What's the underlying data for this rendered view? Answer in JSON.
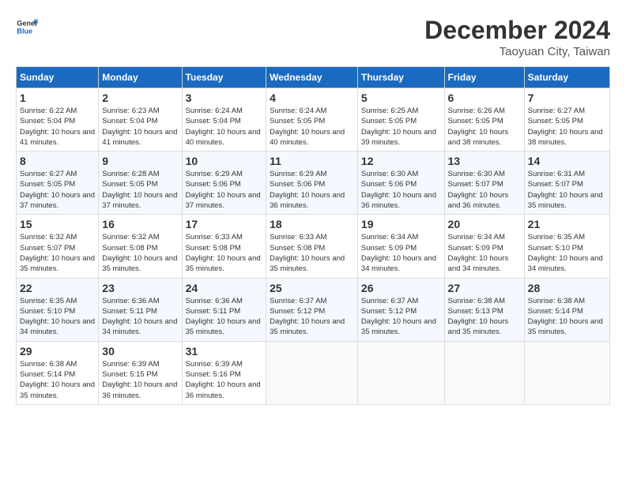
{
  "header": {
    "logo_line1": "General",
    "logo_line2": "Blue",
    "month_title": "December 2024",
    "subtitle": "Taoyuan City, Taiwan"
  },
  "weekdays": [
    "Sunday",
    "Monday",
    "Tuesday",
    "Wednesday",
    "Thursday",
    "Friday",
    "Saturday"
  ],
  "weeks": [
    [
      {
        "day": 1,
        "sunrise": "6:22 AM",
        "sunset": "5:04 PM",
        "daylight": "10 hours and 41 minutes."
      },
      {
        "day": 2,
        "sunrise": "6:23 AM",
        "sunset": "5:04 PM",
        "daylight": "10 hours and 41 minutes."
      },
      {
        "day": 3,
        "sunrise": "6:24 AM",
        "sunset": "5:04 PM",
        "daylight": "10 hours and 40 minutes."
      },
      {
        "day": 4,
        "sunrise": "6:24 AM",
        "sunset": "5:05 PM",
        "daylight": "10 hours and 40 minutes."
      },
      {
        "day": 5,
        "sunrise": "6:25 AM",
        "sunset": "5:05 PM",
        "daylight": "10 hours and 39 minutes."
      },
      {
        "day": 6,
        "sunrise": "6:26 AM",
        "sunset": "5:05 PM",
        "daylight": "10 hours and 38 minutes."
      },
      {
        "day": 7,
        "sunrise": "6:27 AM",
        "sunset": "5:05 PM",
        "daylight": "10 hours and 38 minutes."
      }
    ],
    [
      {
        "day": 8,
        "sunrise": "6:27 AM",
        "sunset": "5:05 PM",
        "daylight": "10 hours and 37 minutes."
      },
      {
        "day": 9,
        "sunrise": "6:28 AM",
        "sunset": "5:05 PM",
        "daylight": "10 hours and 37 minutes."
      },
      {
        "day": 10,
        "sunrise": "6:29 AM",
        "sunset": "5:06 PM",
        "daylight": "10 hours and 37 minutes."
      },
      {
        "day": 11,
        "sunrise": "6:29 AM",
        "sunset": "5:06 PM",
        "daylight": "10 hours and 36 minutes."
      },
      {
        "day": 12,
        "sunrise": "6:30 AM",
        "sunset": "5:06 PM",
        "daylight": "10 hours and 36 minutes."
      },
      {
        "day": 13,
        "sunrise": "6:30 AM",
        "sunset": "5:07 PM",
        "daylight": "10 hours and 36 minutes."
      },
      {
        "day": 14,
        "sunrise": "6:31 AM",
        "sunset": "5:07 PM",
        "daylight": "10 hours and 35 minutes."
      }
    ],
    [
      {
        "day": 15,
        "sunrise": "6:32 AM",
        "sunset": "5:07 PM",
        "daylight": "10 hours and 35 minutes."
      },
      {
        "day": 16,
        "sunrise": "6:32 AM",
        "sunset": "5:08 PM",
        "daylight": "10 hours and 35 minutes."
      },
      {
        "day": 17,
        "sunrise": "6:33 AM",
        "sunset": "5:08 PM",
        "daylight": "10 hours and 35 minutes."
      },
      {
        "day": 18,
        "sunrise": "6:33 AM",
        "sunset": "5:08 PM",
        "daylight": "10 hours and 35 minutes."
      },
      {
        "day": 19,
        "sunrise": "6:34 AM",
        "sunset": "5:09 PM",
        "daylight": "10 hours and 34 minutes."
      },
      {
        "day": 20,
        "sunrise": "6:34 AM",
        "sunset": "5:09 PM",
        "daylight": "10 hours and 34 minutes."
      },
      {
        "day": 21,
        "sunrise": "6:35 AM",
        "sunset": "5:10 PM",
        "daylight": "10 hours and 34 minutes."
      }
    ],
    [
      {
        "day": 22,
        "sunrise": "6:35 AM",
        "sunset": "5:10 PM",
        "daylight": "10 hours and 34 minutes."
      },
      {
        "day": 23,
        "sunrise": "6:36 AM",
        "sunset": "5:11 PM",
        "daylight": "10 hours and 34 minutes."
      },
      {
        "day": 24,
        "sunrise": "6:36 AM",
        "sunset": "5:11 PM",
        "daylight": "10 hours and 35 minutes."
      },
      {
        "day": 25,
        "sunrise": "6:37 AM",
        "sunset": "5:12 PM",
        "daylight": "10 hours and 35 minutes."
      },
      {
        "day": 26,
        "sunrise": "6:37 AM",
        "sunset": "5:12 PM",
        "daylight": "10 hours and 35 minutes."
      },
      {
        "day": 27,
        "sunrise": "6:38 AM",
        "sunset": "5:13 PM",
        "daylight": "10 hours and 35 minutes."
      },
      {
        "day": 28,
        "sunrise": "6:38 AM",
        "sunset": "5:14 PM",
        "daylight": "10 hours and 35 minutes."
      }
    ],
    [
      {
        "day": 29,
        "sunrise": "6:38 AM",
        "sunset": "5:14 PM",
        "daylight": "10 hours and 35 minutes."
      },
      {
        "day": 30,
        "sunrise": "6:39 AM",
        "sunset": "5:15 PM",
        "daylight": "10 hours and 36 minutes."
      },
      {
        "day": 31,
        "sunrise": "6:39 AM",
        "sunset": "5:16 PM",
        "daylight": "10 hours and 36 minutes."
      },
      null,
      null,
      null,
      null
    ]
  ],
  "labels": {
    "sunrise_prefix": "Sunrise: ",
    "sunset_prefix": "Sunset: ",
    "daylight_prefix": "Daylight: "
  }
}
